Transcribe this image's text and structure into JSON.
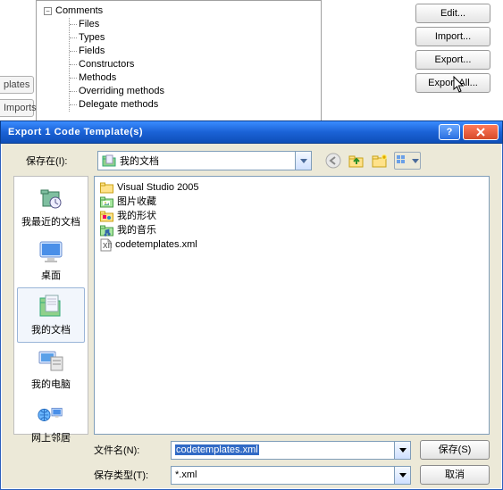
{
  "background": {
    "tree": {
      "root": "Comments",
      "children": [
        "Files",
        "Types",
        "Fields",
        "Constructors",
        "Methods",
        "Overriding methods",
        "Delegate methods"
      ]
    },
    "side_tabs": [
      "plates",
      "Imports"
    ],
    "buttons": {
      "edit": "Edit...",
      "import": "Import...",
      "export": "Export...",
      "export_all": "Export All..."
    }
  },
  "dialog": {
    "title": "Export 1 Code Template(s)",
    "save_in_label": "保存在(I):",
    "save_in_value": "我的文档",
    "places": {
      "recent": "我最近的文档",
      "desktop": "桌面",
      "mydocs": "我的文档",
      "mycomp": "我的电脑",
      "network": "网上邻居"
    },
    "files": {
      "f1": "Visual Studio 2005",
      "f2": "图片收藏",
      "f3": "我的形状",
      "f4": "我的音乐",
      "f5": "codetemplates.xml"
    },
    "filename_label": "文件名(N):",
    "filename_value": "codetemplates.xml",
    "filetype_label": "保存类型(T):",
    "filetype_value": "*.xml",
    "btn_save": "保存(S)",
    "btn_cancel": "取消"
  }
}
